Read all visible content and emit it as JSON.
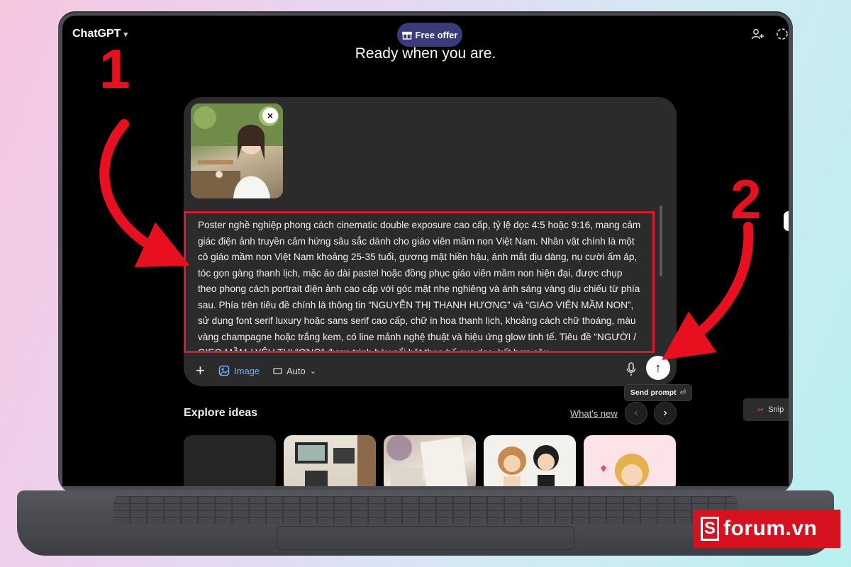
{
  "header": {
    "app_title": "ChatGPT",
    "offer_label": "Free offer"
  },
  "main": {
    "greeting": "Ready when you are."
  },
  "composer": {
    "prompt_text": "Poster nghề nghiệp phong cách cinematic double exposure cao cấp, tỷ lệ dọc 4:5 hoặc 9:16, mang cảm giác điện ảnh truyền cảm hứng sâu sắc dành cho giáo viên mầm non Việt Nam. Nhân vật chính là một cô giáo mầm non Việt Nam khoảng 25-35 tuổi, gương mặt hiền hậu, ánh mắt dịu dàng, nụ cười ấm áp, tóc gọn gàng thanh lịch, mặc áo dài pastel hoặc đồng phục giáo viên mầm non hiện đại, được chụp theo phong cách portrait điện ảnh cao cấp với góc mặt nhẹ nghiêng và ánh sáng vàng dịu chiếu từ phía sau. Phía trên tiêu đề chính là thông tin “NGUYỄN THỊ THANH HƯƠNG” và “GIÁO VIÊN MẦM NON”, sử dụng font serif luxury hoặc sans serif cao cấp, chữ in hoa thanh lịch, khoảng cách chữ thoáng, màu vàng champagne hoặc trắng kem, có line mảnh nghệ thuật và hiệu ứng glow tinh tế. Tiêu đề “NGƯỜI / GIEO MẦM / YÊU THƯƠNG” được trình bày nổi bật theo bố cục dọc, kết hợp câu",
    "image_tool_label": "Image",
    "model_label": "Auto",
    "send_tooltip": "Send prompt"
  },
  "explore": {
    "title": "Explore ideas",
    "whats_new": "What's new"
  },
  "taskbar": {
    "snip_label": "Snip"
  },
  "annotations": {
    "step1": "1",
    "step2": "2",
    "color": "#e8101f"
  },
  "watermark": {
    "mark": "S",
    "text": "forum.vn"
  },
  "colors": {
    "accent_blue": "#6fb3ff",
    "highlight_red": "#e0192a",
    "offer_bg": "#3b3a7a"
  }
}
